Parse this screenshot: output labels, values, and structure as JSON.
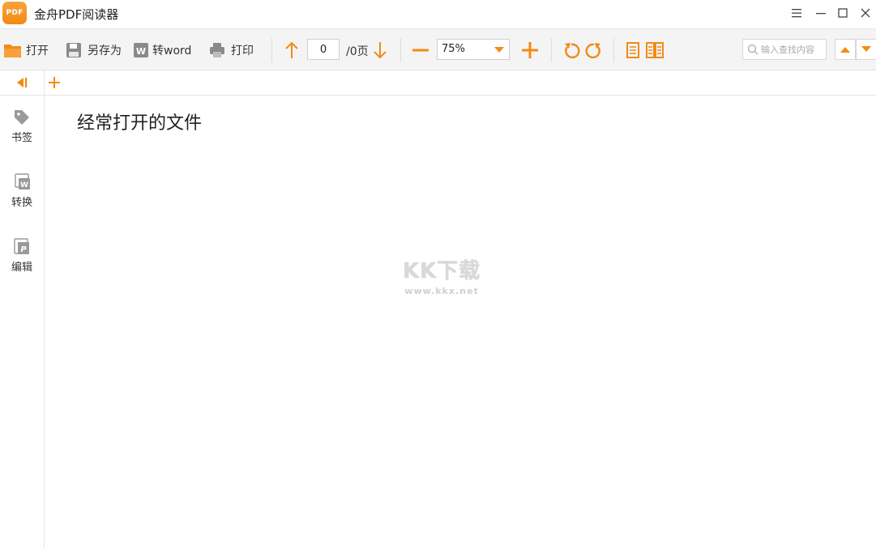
{
  "window": {
    "title": "金舟PDF阅读器",
    "logo_text": "PDF"
  },
  "toolbar": {
    "open_label": "打开",
    "save_as_label": "另存为",
    "to_word_label": "转word",
    "print_label": "打印",
    "page_current": "0",
    "page_total": "/0页",
    "zoom_value": "75%",
    "search_placeholder": "输入查找内容"
  },
  "sidebar": {
    "items": [
      {
        "label": "书签",
        "icon": "bookmark-tag-icon"
      },
      {
        "label": "转换",
        "icon": "convert-word-icon"
      },
      {
        "label": "编辑",
        "icon": "edit-pdf-icon"
      }
    ]
  },
  "main": {
    "recent_title": "经常打开的文件"
  },
  "watermark": {
    "text": "KK下载",
    "url": "www.kkx.net"
  },
  "colors": {
    "accent": "#f28a14",
    "icon_gray": "#8a8a8a"
  }
}
